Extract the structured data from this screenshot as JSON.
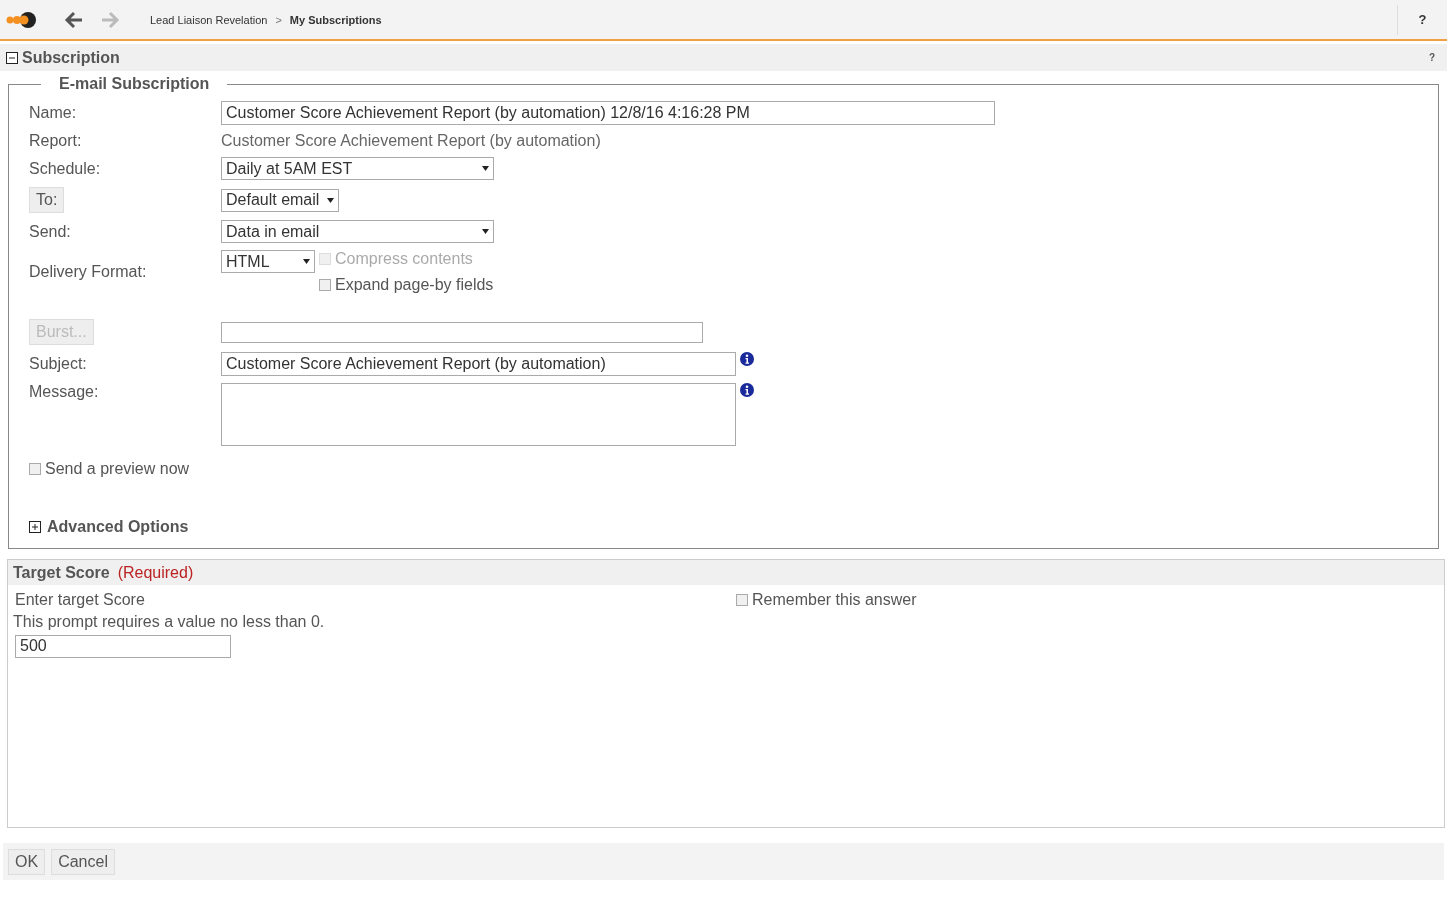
{
  "toolbar": {
    "breadcrumb": [
      {
        "label": "Lead Liaison Revelation",
        "current": false
      },
      {
        "label": "My Subscriptions",
        "current": true
      }
    ],
    "separator": ">",
    "help": "?"
  },
  "section": {
    "title": "Subscription",
    "expanded": true,
    "help": "?"
  },
  "fieldset": {
    "legend": "E-mail Subscription",
    "rows": [
      {
        "kind": "input",
        "label": "Name:",
        "value": "Customer Score Achievement Report (by automation) 12/8/16 4:16:28 PM"
      },
      {
        "kind": "static",
        "label": "Report:",
        "value": "Customer Score Achievement Report (by automation)"
      },
      {
        "kind": "select",
        "label": "Schedule:",
        "value": "Daily at 5AM EST"
      },
      {
        "kind": "button-select",
        "label": "To:",
        "disabled": false,
        "value": "Default email"
      },
      {
        "kind": "select",
        "label": "Send:",
        "value": "Data in email"
      },
      {
        "kind": "select-options",
        "label": "Delivery Format:",
        "value": "HTML",
        "options": [
          {
            "label": "Compress contents",
            "checked": false,
            "disabled": true
          },
          {
            "label": "Expand page-by fields",
            "checked": false,
            "disabled": false
          }
        ]
      },
      {
        "kind": "button-input",
        "label": "Burst...",
        "disabled": true,
        "value": ""
      },
      {
        "kind": "info-input",
        "label": "Subject:",
        "value": "Customer Score Achievement Report (by automation)"
      },
      {
        "kind": "info-textarea",
        "label": "Message:",
        "value": ""
      }
    ],
    "preview": {
      "label": "Send a preview now",
      "checked": false
    },
    "advanced": {
      "label": "Advanced Options",
      "expanded": false
    }
  },
  "prompt": {
    "title": "Target Score",
    "required": "(Required)",
    "label": "Enter target Score",
    "remember": {
      "label": "Remember this answer",
      "checked": false
    },
    "note": "This prompt requires a value no less than 0.",
    "value": "500"
  },
  "buttons": [
    "OK",
    "Cancel"
  ]
}
